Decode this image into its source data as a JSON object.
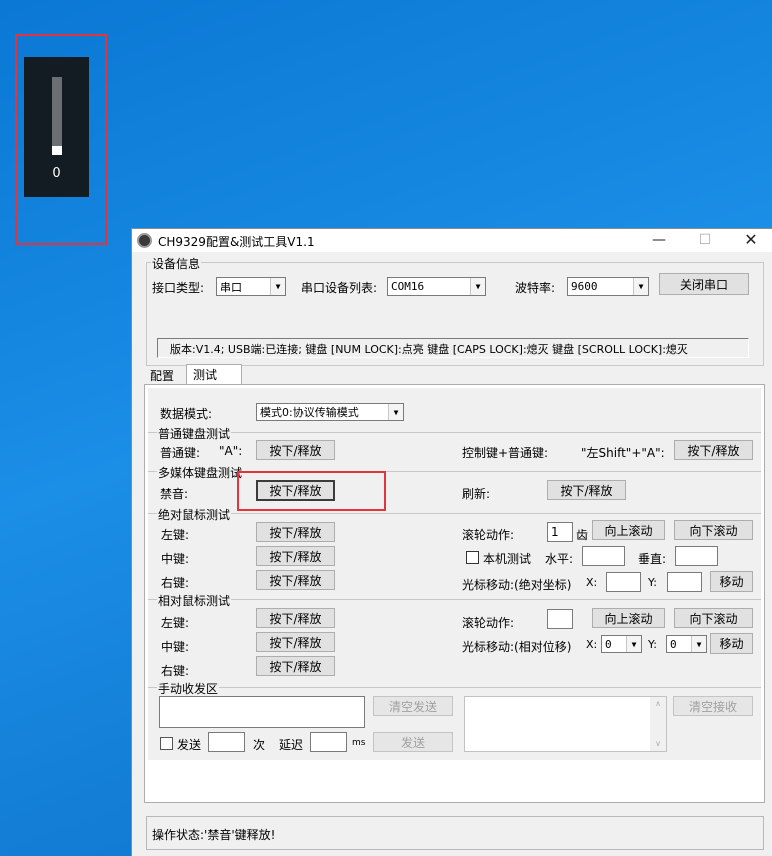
{
  "osd": {
    "volume_value": "0",
    "level_fraction": 0.0
  },
  "window": {
    "title": "CH9329配置&测试工具V1.1",
    "controls": {
      "minimize": "—",
      "maximize": "☐",
      "close": "✕"
    }
  },
  "device_info": {
    "group_label": "设备信息",
    "interface_type_label": "接口类型:",
    "interface_type_value": "串口",
    "serial_list_label": "串口设备列表:",
    "serial_list_value": "COM16",
    "baud_label": "波特率:",
    "baud_value": "9600",
    "close_port_button": "关闭串口",
    "version_status": "版本:V1.4;  USB端:已连接;  键盘 [NUM LOCK]:点亮  键盘 [CAPS LOCK]:熄灭  键盘 [SCROLL LOCK]:熄灭"
  },
  "tabs": [
    {
      "label": "配置"
    },
    {
      "label": "测试"
    }
  ],
  "test": {
    "data_mode_label": "数据模式:",
    "data_mode_value": "模式0:协议传输模式",
    "normal_kb": {
      "group_label": "普通键盘测试",
      "normal_key_label": "普通键:",
      "normal_key_value": "\"A\":",
      "press_release": "按下/释放",
      "combo_label": "控制键+普通键:",
      "combo_value": "\"左Shift\"+\"A\":"
    },
    "media_kb": {
      "group_label": "多媒体键盘测试",
      "mute_label": "禁音:",
      "refresh_label": "刷新:"
    },
    "abs_mouse": {
      "group_label": "绝对鼠标测试",
      "left_label": "左键:",
      "middle_label": "中键:",
      "right_label": "右键:",
      "wheel_label": "滚轮动作:",
      "wheel_value": "1",
      "wheel_unit": "齿",
      "scroll_up": "向上滚动",
      "scroll_down": "向下滚动",
      "local_test_label": "本机测试",
      "horizontal_label": "水平:",
      "vertical_label": "垂直:",
      "cursor_label": "光标移动:(绝对坐标)",
      "x_label": "X:",
      "y_label": "Y:",
      "move_button": "移动"
    },
    "rel_mouse": {
      "group_label": "相对鼠标测试",
      "left_label": "左键:",
      "middle_label": "中键:",
      "right_label": "右键:",
      "wheel_label": "滚轮动作:",
      "cursor_label": "光标移动:(相对位移)",
      "x_value": "0",
      "y_value": "0"
    },
    "manual": {
      "group_label": "手动收发区",
      "clear_send": "清空发送",
      "clear_recv": "清空接收",
      "send_label": "发送",
      "times_label": "次",
      "delay_label": "延迟",
      "ms_label": "ms",
      "send_button": "发送"
    }
  },
  "status_bar": {
    "text": "操作状态:'禁音'键释放!"
  },
  "colors": {
    "desktop": "#0a78d4",
    "highlight": "#e0353b",
    "dialog": "#f0f0f0"
  }
}
